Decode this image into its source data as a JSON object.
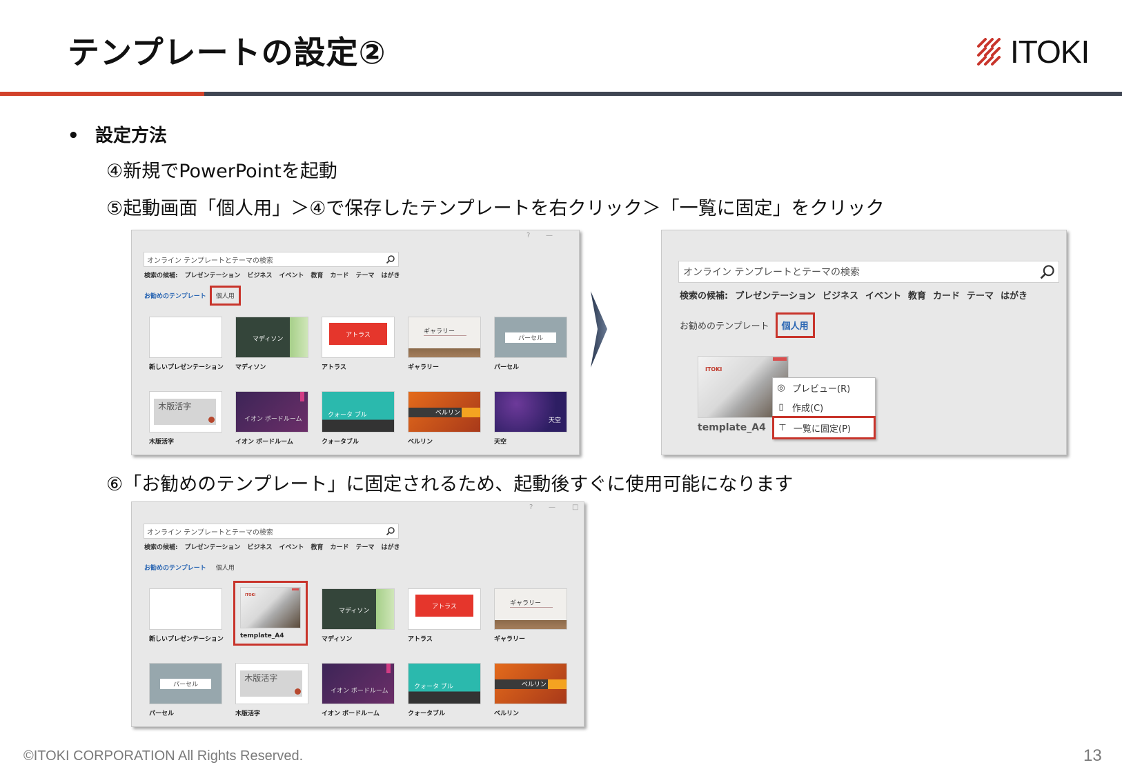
{
  "title": "テンプレートの設定②",
  "logo": {
    "text": "ITOKI"
  },
  "bullet": {
    "heading": "設定方法"
  },
  "steps": {
    "step4": "④新規でPowerPointを起動",
    "step5": "⑤起動画面「個人用」＞④で保存したテンプレートを右クリック＞「一覧に固定」をクリック",
    "step6": "⑥「お勧めのテンプレート」に固定されるため、起動後すぐに使用可能になります"
  },
  "ppt": {
    "search_placeholder": "オンライン テンプレートとテーマの検索",
    "suggest_label": "検索の候補:",
    "suggestions": [
      "プレゼンテーション",
      "ビジネス",
      "イベント",
      "教育",
      "カード",
      "テーマ",
      "はがき"
    ],
    "tab_recommended": "お勧めのテンプレート",
    "tab_personal": "個人用",
    "window_controls": [
      "?",
      "—",
      "□"
    ]
  },
  "screen1": {
    "tiles": [
      {
        "caption": "新しいプレゼンテーション",
        "label": ""
      },
      {
        "caption": "マディソン",
        "label": "マディソン"
      },
      {
        "caption": "アトラス",
        "label": "アトラス"
      },
      {
        "caption": "ギャラリー",
        "label": "ギャラリー"
      },
      {
        "caption": "パーセル",
        "label": "パーセル"
      },
      {
        "caption": "木版活字",
        "label": "木版活字"
      },
      {
        "caption": "イオン ボードルーム",
        "label": "イオン ボードルーム"
      },
      {
        "caption": "クォータブル",
        "label": "クォータ ブル"
      },
      {
        "caption": "ベルリン",
        "label": "ベルリン"
      },
      {
        "caption": "天空",
        "label": "天空"
      }
    ]
  },
  "screen2": {
    "template_caption": "template_A4",
    "template_mini": "ITOKI",
    "menu": [
      "プレビュー(R)",
      "作成(C)",
      "一覧に固定(P)"
    ]
  },
  "screen3": {
    "tiles": [
      {
        "caption": "新しいプレゼンテーション",
        "label": ""
      },
      {
        "caption": "template_A4",
        "label": "ITOKI"
      },
      {
        "caption": "マディソン",
        "label": "マディソン"
      },
      {
        "caption": "アトラス",
        "label": "アトラス"
      },
      {
        "caption": "ギャラリー",
        "label": "ギャラリー"
      },
      {
        "caption": "パーセル",
        "label": "パーセル"
      },
      {
        "caption": "木版活字",
        "label": "木版活字"
      },
      {
        "caption": "イオン ボードルーム",
        "label": "イオン ボードルーム"
      },
      {
        "caption": "クォータブル",
        "label": "クォータ ブル"
      },
      {
        "caption": "ベルリン",
        "label": "ベルリン"
      }
    ]
  },
  "footer": {
    "copyright": "©ITOKI CORPORATION All Rights Reserved.",
    "page": "13"
  },
  "colors": {
    "accent_red": "#d2412a",
    "rule_gray": "#3f4552",
    "highlight": "#c8342b",
    "link_blue": "#2a66b3"
  }
}
